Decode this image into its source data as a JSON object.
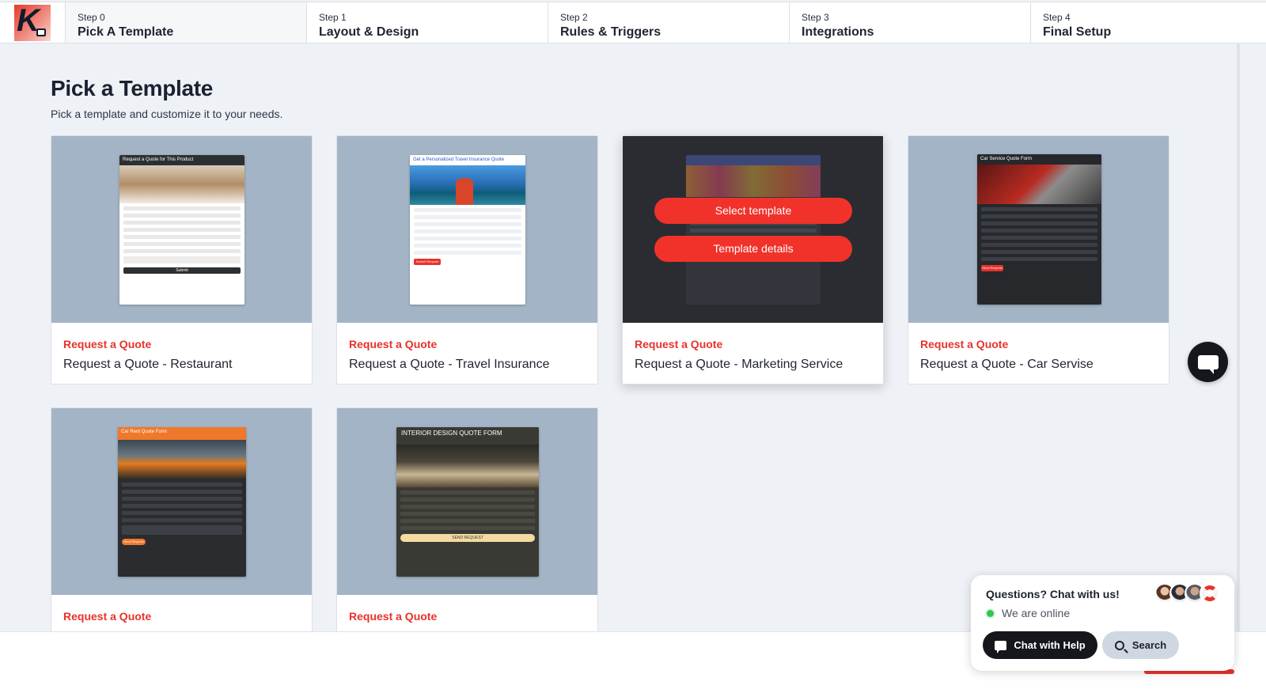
{
  "steps": [
    {
      "num": "Step 0",
      "name": "Pick A Template"
    },
    {
      "num": "Step 1",
      "name": "Layout & Design"
    },
    {
      "num": "Step 2",
      "name": "Rules & Triggers"
    },
    {
      "num": "Step 3",
      "name": "Integrations"
    },
    {
      "num": "Step 4",
      "name": "Final Setup"
    }
  ],
  "page": {
    "title": "Pick a Template",
    "subtitle": "Pick a template and customize it to your needs."
  },
  "cards": [
    {
      "tag": "Request a Quote",
      "title": "Request a Quote - Restaurant",
      "preview_header": "Request a Quote for This Product",
      "preview_button": "Submit"
    },
    {
      "tag": "Request a Quote",
      "title": "Request a Quote - Travel Insurance",
      "preview_header": "Get a Personalized Travel Insurance Quote",
      "preview_button": "Submit Request"
    },
    {
      "tag": "Request a Quote",
      "title": "Request a Quote - Marketing Service"
    },
    {
      "tag": "Request a Quote",
      "title": "Request a Quote - Car Servise",
      "preview_header": "Car Service Quote Form",
      "preview_button": "Send Request"
    },
    {
      "tag": "Request a Quote",
      "title": "",
      "preview_header": "Car Rent Quote Form",
      "preview_button": "Send Request"
    },
    {
      "tag": "Request a Quote",
      "title": "",
      "preview_header": "INTERIOR DESIGN QUOTE FORM",
      "preview_button": "SEND REQUEST"
    }
  ],
  "hover_overlay": {
    "select_label": "Select template",
    "details_label": "Template details"
  },
  "chat": {
    "title": "Questions? Chat with us!",
    "status": "We are online",
    "chat_button": "Chat with Help",
    "search_button": "Search"
  },
  "colors": {
    "accent": "#e8322c",
    "thumb_bg": "#a3b4c6",
    "page_bg": "#eef1f5",
    "online": "#35c353"
  }
}
